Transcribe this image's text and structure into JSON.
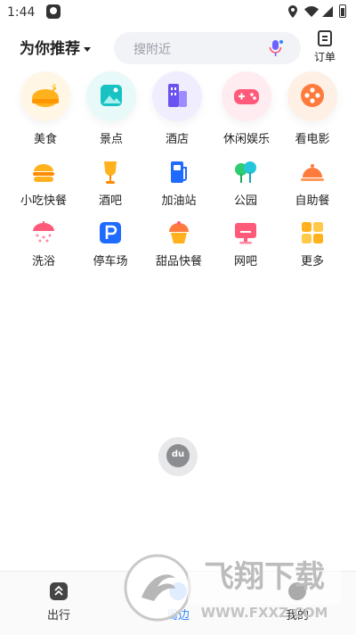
{
  "status_bar": {
    "time": "1:44"
  },
  "header": {
    "recommend_label": "为你推荐",
    "search_placeholder": "搜附近",
    "orders_label": "订单"
  },
  "top_categories": [
    {
      "label": "美食",
      "icon": "chicken-icon",
      "color": "#ffb21e"
    },
    {
      "label": "景点",
      "icon": "picture-icon",
      "color": "#19c2c2"
    },
    {
      "label": "酒店",
      "icon": "building-icon",
      "color": "#6a52f0"
    },
    {
      "label": "休闲娱乐",
      "icon": "gamepad-icon",
      "color": "#ff5a7a"
    },
    {
      "label": "看电影",
      "icon": "film-reel-icon",
      "color": "#ff7a3d"
    }
  ],
  "grid_categories": [
    [
      {
        "label": "小吃快餐",
        "icon": "burger-icon"
      },
      {
        "label": "酒吧",
        "icon": "wine-glass-icon"
      },
      {
        "label": "加油站",
        "icon": "fuel-pump-icon"
      },
      {
        "label": "公园",
        "icon": "tree-icon"
      },
      {
        "label": "自助餐",
        "icon": "food-cloche-icon"
      }
    ],
    [
      {
        "label": "洗浴",
        "icon": "shower-icon"
      },
      {
        "label": "停车场",
        "icon": "parking-icon"
      },
      {
        "label": "甜品快餐",
        "icon": "cupcake-icon"
      },
      {
        "label": "网吧",
        "icon": "monitor-icon"
      },
      {
        "label": "更多",
        "icon": "grid-more-icon"
      }
    ]
  ],
  "map_marker": {
    "label": "du"
  },
  "bottom_nav": [
    {
      "label": "出行",
      "icon": "travel-icon"
    },
    {
      "label": "周边",
      "icon": "nearby-icon",
      "active": true
    },
    {
      "label": "我的",
      "icon": "profile-icon"
    }
  ],
  "watermark": {
    "title": "飞翔下载",
    "url": "WWW.FXXZ.COM"
  },
  "colors": {
    "accent": "#3385ff",
    "text": "#222222",
    "search_bg": "#f2f3f6"
  }
}
